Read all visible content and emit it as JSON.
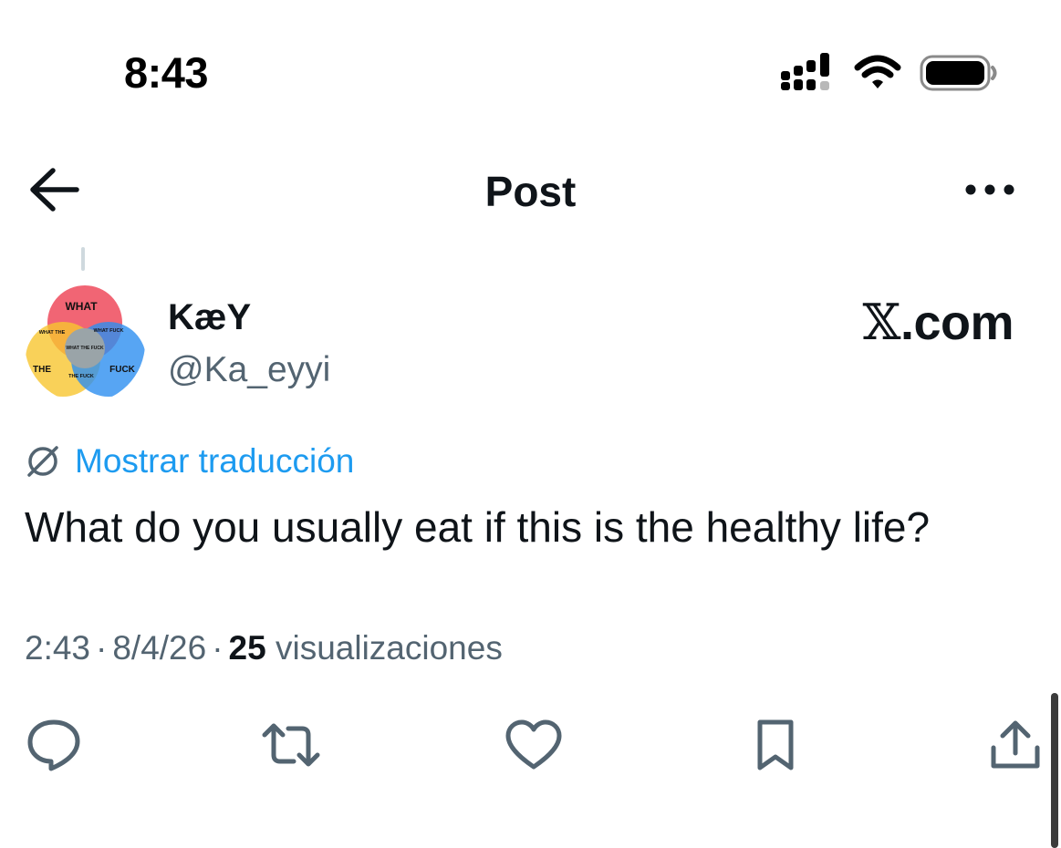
{
  "status_bar": {
    "time": "8:43",
    "icons": [
      "cellular-signal-icon",
      "wifi-icon",
      "battery-icon"
    ]
  },
  "header": {
    "title": "Post",
    "back_icon": "arrow-left-icon",
    "more_icon": "more-horizontal-icon"
  },
  "post": {
    "author": {
      "display_name": "KæY",
      "handle": "@Ka_eyyi",
      "avatar_labels": {
        "top": "WHAT",
        "left": "THE",
        "right": "FUCK",
        "top_left": "WHAT THE",
        "top_right": "WHAT FUCK",
        "bottom": "THE FUCK",
        "center": "WHAT THE FUCK"
      }
    },
    "watermark": {
      "x": "𝕏",
      "domain": ".com"
    },
    "translate_label": "Mostrar traducción",
    "text": "What do you usually eat if this is the healthy life?",
    "meta": {
      "time": "2:43",
      "date": "8/4/26",
      "separator": "·",
      "views_count": "25",
      "views_label": "visualizaciones"
    }
  },
  "actions": [
    "reply-icon",
    "repost-icon",
    "like-icon",
    "bookmark-icon",
    "share-icon"
  ],
  "colors": {
    "text_primary": "#0f1419",
    "text_secondary": "#536471",
    "link": "#1d9bf0",
    "venn_red": "#ee4a5c",
    "venn_yellow": "#f7c52f",
    "venn_blue": "#2d8ff0",
    "venn_green": "#7cbf5a"
  }
}
